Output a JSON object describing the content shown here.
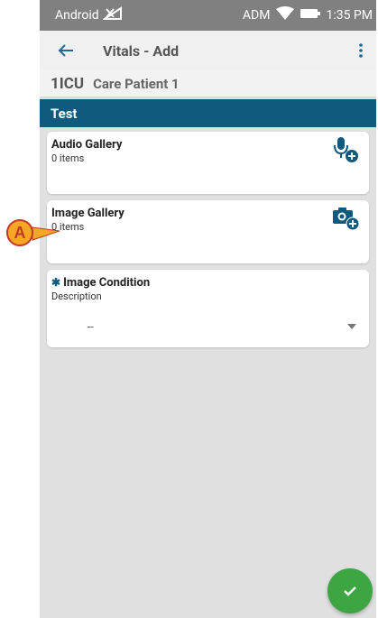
{
  "status_bar": {
    "carrier": "Android",
    "operator": "ADM",
    "time": "1:35 PM"
  },
  "app_bar": {
    "title": "Vitals - Add",
    "back_icon": "arrow-left-icon",
    "menu_icon": "more-vert-icon"
  },
  "patient": {
    "bed": "1ICU",
    "name": "Care Patient 1"
  },
  "section": {
    "title": "Test"
  },
  "audio_gallery": {
    "title": "Audio Gallery",
    "count": "0 items",
    "icon": "mic-add-icon"
  },
  "image_gallery": {
    "title": "Image Gallery",
    "count": "0 items",
    "icon": "camera-add-icon"
  },
  "image_condition": {
    "title": "Image Condition",
    "label": "Description",
    "selected": "--",
    "required_icon": "asterisk-icon"
  },
  "annotation": {
    "letter": "A"
  },
  "colors": {
    "section_bar": "#105a7d",
    "fab": "#3da541",
    "status_bar": "#808080",
    "annotation_marker": "#f5a623"
  }
}
